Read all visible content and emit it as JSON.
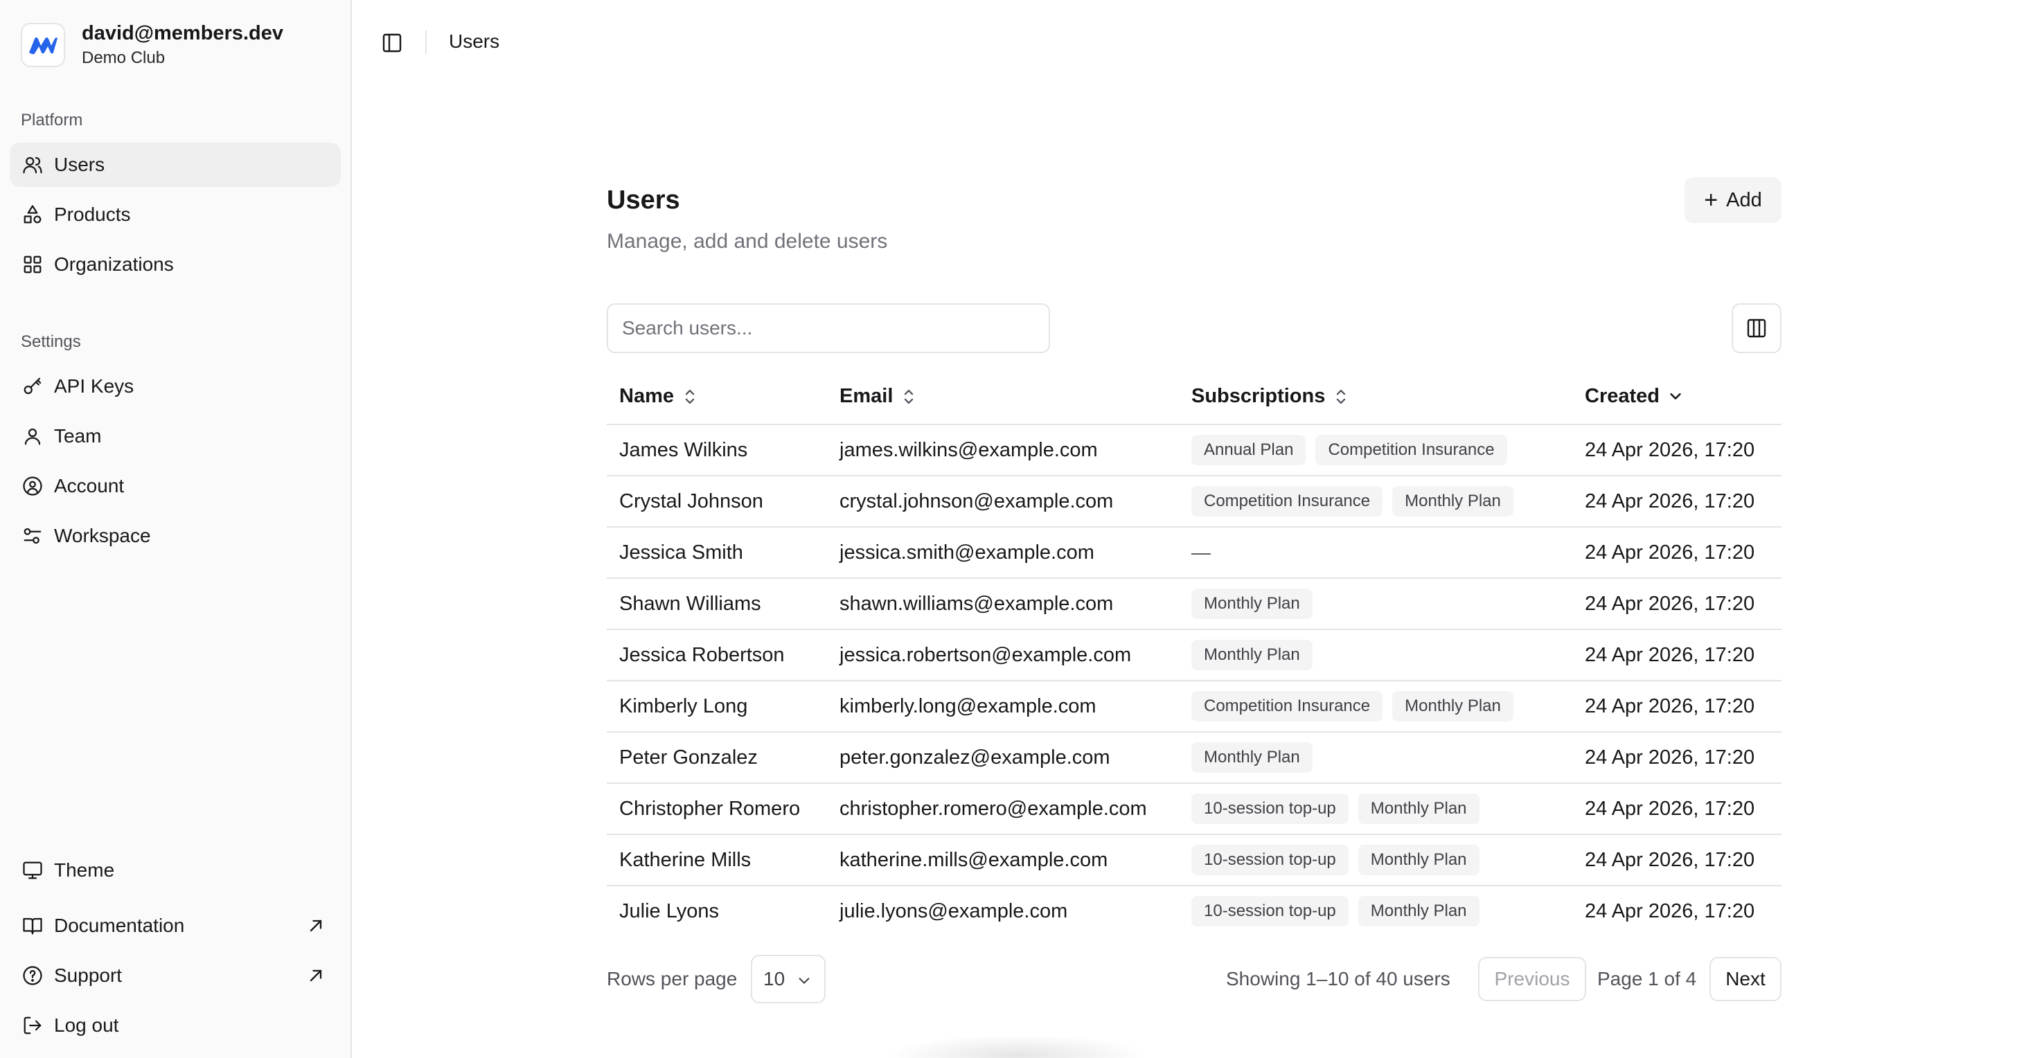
{
  "account": {
    "email": "david@members.dev",
    "club": "Demo Club"
  },
  "sidebar": {
    "platform_label": "Platform",
    "platform_items": [
      {
        "label": "Users"
      },
      {
        "label": "Products"
      },
      {
        "label": "Organizations"
      }
    ],
    "settings_label": "Settings",
    "settings_items": [
      {
        "label": "API Keys"
      },
      {
        "label": "Team"
      },
      {
        "label": "Account"
      },
      {
        "label": "Workspace"
      }
    ],
    "bottom_items": [
      {
        "label": "Theme"
      },
      {
        "label": "Documentation"
      },
      {
        "label": "Support"
      },
      {
        "label": "Log out"
      }
    ]
  },
  "topbar": {
    "breadcrumb": "Users"
  },
  "main": {
    "title": "Users",
    "subtitle": "Manage, add and delete users",
    "add_label": "Add",
    "search_placeholder": "Search users..."
  },
  "table": {
    "headers": {
      "name": "Name",
      "email": "Email",
      "subscriptions": "Subscriptions",
      "created": "Created"
    },
    "rows": [
      {
        "name": "James Wilkins",
        "email": "james.wilkins@example.com",
        "subs": [
          "Annual Plan",
          "Competition Insurance"
        ],
        "created": "24 Apr 2026, 17:20"
      },
      {
        "name": "Crystal Johnson",
        "email": "crystal.johnson@example.com",
        "subs": [
          "Competition Insurance",
          "Monthly Plan"
        ],
        "created": "24 Apr 2026, 17:20"
      },
      {
        "name": "Jessica Smith",
        "email": "jessica.smith@example.com",
        "subs": [],
        "empty": "—",
        "created": "24 Apr 2026, 17:20"
      },
      {
        "name": "Shawn Williams",
        "email": "shawn.williams@example.com",
        "subs": [
          "Monthly Plan"
        ],
        "created": "24 Apr 2026, 17:20"
      },
      {
        "name": "Jessica Robertson",
        "email": "jessica.robertson@example.com",
        "subs": [
          "Monthly Plan"
        ],
        "created": "24 Apr 2026, 17:20"
      },
      {
        "name": "Kimberly Long",
        "email": "kimberly.long@example.com",
        "subs": [
          "Competition Insurance",
          "Monthly Plan"
        ],
        "created": "24 Apr 2026, 17:20"
      },
      {
        "name": "Peter Gonzalez",
        "email": "peter.gonzalez@example.com",
        "subs": [
          "Monthly Plan"
        ],
        "created": "24 Apr 2026, 17:20"
      },
      {
        "name": "Christopher Romero",
        "email": "christopher.romero@example.com",
        "subs": [
          "10-session top-up",
          "Monthly Plan"
        ],
        "created": "24 Apr 2026, 17:20"
      },
      {
        "name": "Katherine Mills",
        "email": "katherine.mills@example.com",
        "subs": [
          "10-session top-up",
          "Monthly Plan"
        ],
        "created": "24 Apr 2026, 17:20"
      },
      {
        "name": "Julie Lyons",
        "email": "julie.lyons@example.com",
        "subs": [
          "10-session top-up",
          "Monthly Plan"
        ],
        "created": "24 Apr 2026, 17:20"
      }
    ]
  },
  "footer": {
    "rows_per_page_label": "Rows per page",
    "rows_per_page_value": "10",
    "showing": "Showing 1–10 of 40 users",
    "previous": "Previous",
    "page_info": "Page 1 of 4",
    "next": "Next"
  },
  "colors": {
    "brand_blue": "#2563eb",
    "sidebar_bg": "#fafafa",
    "active_item_bg": "#efeff0",
    "chip_bg": "#f4f4f5"
  }
}
